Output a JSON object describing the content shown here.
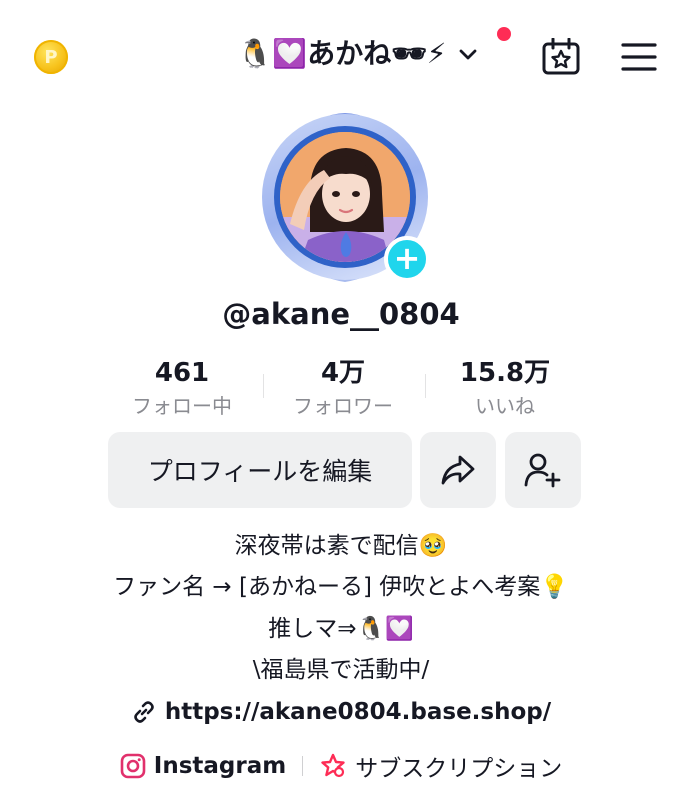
{
  "header": {
    "coin_glyph": "P",
    "title": "🐧💟あかね🕶⚡",
    "has_notification": true,
    "notification_color": "#fe2c55"
  },
  "profile": {
    "username": "@akane__0804",
    "add_glyph": "+"
  },
  "stats": [
    {
      "value": "461",
      "label": "フォロー中"
    },
    {
      "value": "4万",
      "label": "フォロワー"
    },
    {
      "value": "15.8万",
      "label": "いいね"
    }
  ],
  "actions": {
    "edit_profile": "プロフィールを編集"
  },
  "bio": {
    "lines": [
      "深夜帯は素で配信🥹",
      "ファン名 → [あかねーる] 伊吹とよへ考案💡",
      "推しマ⇒🐧💟",
      "\\福島県で活動中/"
    ],
    "link": "https://akane0804.base.shop/"
  },
  "links": {
    "instagram": "Instagram",
    "subscription": "サブスクリプション"
  },
  "colors": {
    "accent_cyan": "#20d5ec",
    "notification_red": "#fe2c55",
    "button_bg": "#eff0f1",
    "muted_text": "#8a8b91",
    "coin_gold": "#f7c21b",
    "instagram_pink": "#e1306c"
  },
  "icons": {
    "coin": "coin-icon",
    "chevron": "chevron-down-icon",
    "calendar": "calendar-star-icon",
    "menu": "hamburger-menu-icon",
    "share": "share-arrow-icon",
    "add_user": "add-user-icon",
    "link": "link-icon",
    "instagram": "instagram-icon",
    "subscription": "subscription-star-icon"
  }
}
